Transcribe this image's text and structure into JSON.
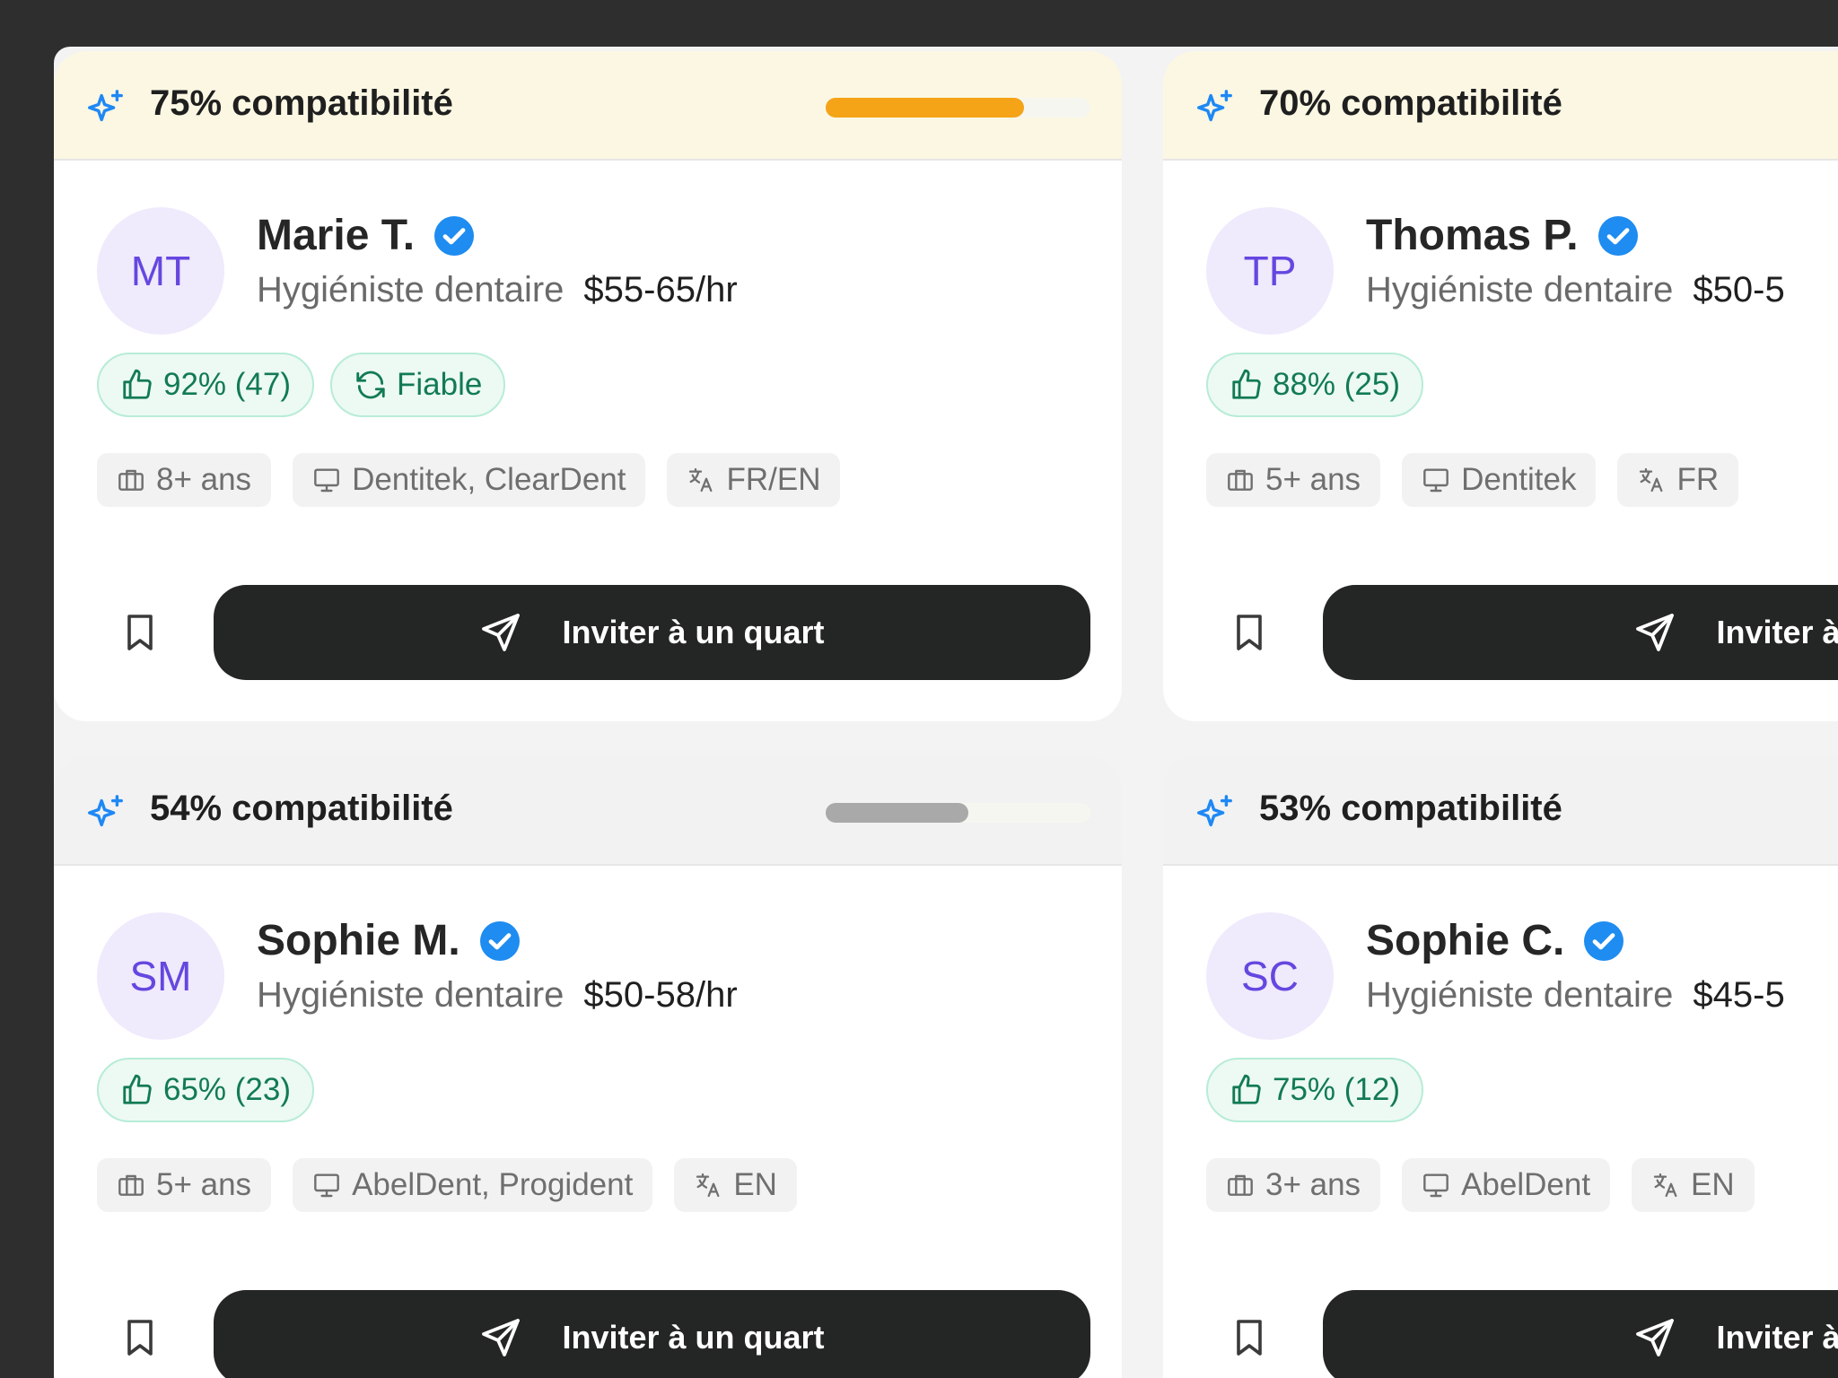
{
  "cards": [
    {
      "match": "75% compatibilité",
      "match_level": 0.75,
      "bar_color": "#f5a317",
      "initials": "MT",
      "name": "Marie T.",
      "role": "Hygiéniste dentaire",
      "rate": "$55-65/hr",
      "rating": "92% (47)",
      "reliable": "Fiable",
      "experience": "8+ ans",
      "software": "Dentitek, ClearDent",
      "languages": "FR/EN",
      "invite": "Inviter à un quart"
    },
    {
      "match": "70% compatibilité",
      "match_level": 0.7,
      "bar_color": "#f5a317",
      "initials": "TP",
      "name": "Thomas P.",
      "role": "Hygiéniste dentaire",
      "rate": "$50-5",
      "rating": "88% (25)",
      "experience": "5+ ans",
      "software": "Dentitek",
      "languages": "FR",
      "invite": "Inviter à un"
    },
    {
      "match": "54% compatibilité",
      "match_level": 0.54,
      "bar_color": "#a9a9a9",
      "initials": "SM",
      "name": "Sophie M.",
      "role": "Hygiéniste dentaire",
      "rate": "$50-58/hr",
      "rating": "65% (23)",
      "experience": "5+ ans",
      "software": "AbelDent, Progident",
      "languages": "EN",
      "invite": "Inviter à un quart"
    },
    {
      "match": "53% compatibilité",
      "match_level": 0.53,
      "bar_color": "#a9a9a9",
      "initials": "SC",
      "name": "Sophie C.",
      "role": "Hygiéniste dentaire",
      "rate": "$45-5",
      "rating": "75% (12)",
      "experience": "3+ ans",
      "software": "AbelDent",
      "languages": "EN",
      "invite": "Inviter à un"
    }
  ],
  "colors": {
    "spark_blue": "#1e88f5",
    "verified_blue": "#1e8cf0",
    "invite_bg": "#242625"
  },
  "icons": {
    "match": "sparkles-icon",
    "verified": "verified-badge-icon",
    "rating": "thumbs-up-icon",
    "reliable": "refresh-icon",
    "experience": "briefcase-icon",
    "software": "monitor-icon",
    "languages": "translate-icon",
    "save": "bookmark-icon",
    "invite": "send-icon"
  }
}
